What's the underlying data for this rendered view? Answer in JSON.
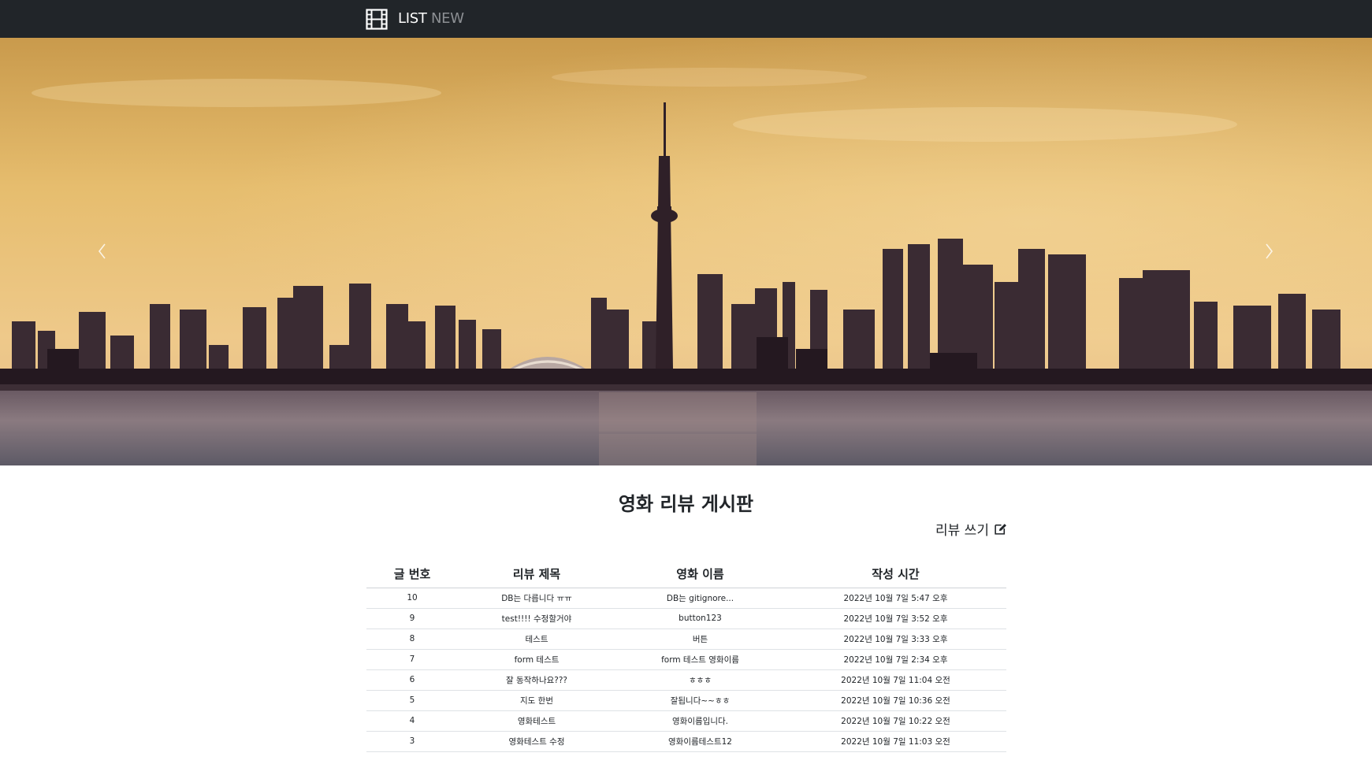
{
  "navbar": {
    "brand_icon": "film-icon",
    "links": [
      {
        "label": "LIST"
      },
      {
        "label": "NEW"
      }
    ]
  },
  "carousel": {
    "prev_icon": "chevron-left-icon",
    "next_icon": "chevron-right-icon"
  },
  "board": {
    "title": "영화 리뷰 게시판",
    "write_label": "리뷰 쓰기",
    "write_icon": "pencil-square-icon",
    "columns": [
      "글 번호",
      "리뷰 제목",
      "영화 이름",
      "작성 시간"
    ],
    "rows": [
      [
        "10",
        "DB는 다릅니다 ㅠㅠ",
        "DB는 gitignore...",
        "2022년 10월 7일 5:47 오후"
      ],
      [
        "9",
        "test!!!! 수정할거야",
        "button123",
        "2022년 10월 7일 3:52 오후"
      ],
      [
        "8",
        "테스트",
        "버튼",
        "2022년 10월 7일 3:33 오후"
      ],
      [
        "7",
        "form 테스트",
        "form 테스트 영화이름",
        "2022년 10월 7일 2:34 오후"
      ],
      [
        "6",
        "잘 동작하나요???",
        "ㅎㅎㅎ",
        "2022년 10월 7일 11:04 오전"
      ],
      [
        "5",
        "지도 한번",
        "잘됩니다~~ㅎㅎ",
        "2022년 10월 7일 10:36 오전"
      ],
      [
        "4",
        "영화테스트",
        "영화이름입니다.",
        "2022년 10월 7일 10:22 오전"
      ],
      [
        "3",
        "영화테스트 수정",
        "영화이름테스트12",
        "2022년 10월 7일 11:03 오전"
      ]
    ]
  },
  "colors": {
    "navbar_bg": "#212529",
    "nav_active": "#ffffff",
    "nav_inactive": "#8c8f93"
  }
}
